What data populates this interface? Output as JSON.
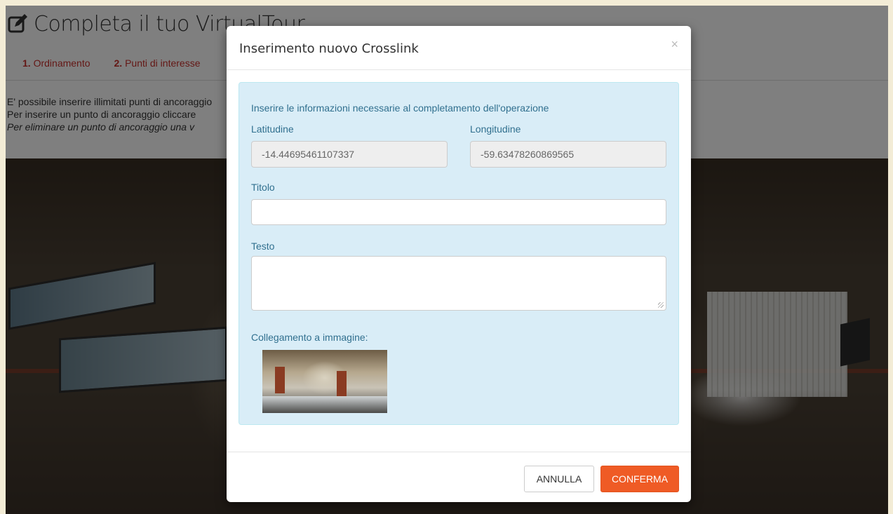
{
  "page": {
    "title": "Completa il tuo VirtualTour",
    "title_icon": "edit-icon",
    "steps": [
      {
        "num": "1.",
        "label": "Ordinamento"
      },
      {
        "num": "2.",
        "label": "Punti di interesse"
      }
    ],
    "instructions": {
      "line1": "E' possibile inserire illimitati punti di ancoraggio",
      "line2": "Per inserire un punto di ancoraggio cliccare",
      "line3": "Per eliminare un punto di ancoraggio una v"
    }
  },
  "modal": {
    "title": "Inserimento nuovo Crosslink",
    "close_glyph": "×",
    "message": "Inserire le informazioni necessarie al completamento dell'operazione",
    "latitude": {
      "label": "Latitudine",
      "value": "-14.44695461107337"
    },
    "longitude": {
      "label": "Longitudine",
      "value": "-59.63478260869565"
    },
    "titolo": {
      "label": "Titolo",
      "value": ""
    },
    "testo": {
      "label": "Testo",
      "value": ""
    },
    "image_link": {
      "label": "Collegamento a immagine:"
    },
    "buttons": {
      "cancel": "ANNULLA",
      "confirm": "CONFERMA"
    }
  },
  "colors": {
    "accent": "#ef5b25",
    "info_bg": "#d9edf7",
    "info_text": "#31708f",
    "step_color": "#c9302c"
  }
}
